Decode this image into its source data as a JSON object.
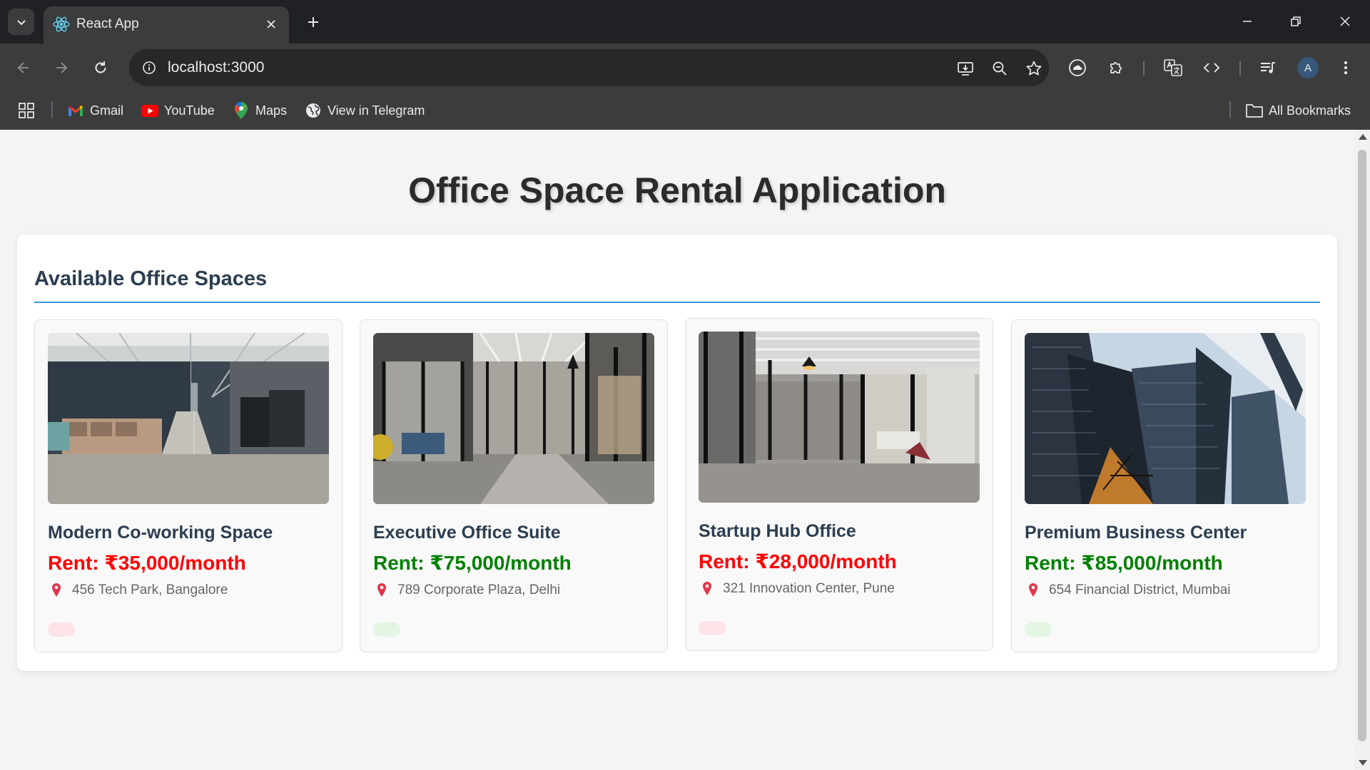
{
  "browser": {
    "tab_title": "React App",
    "url": "localhost:3000",
    "avatar_letter": "A",
    "bookmarks": [
      {
        "label": "Gmail",
        "icon": "gmail-icon"
      },
      {
        "label": "YouTube",
        "icon": "youtube-icon"
      },
      {
        "label": "Maps",
        "icon": "maps-icon"
      },
      {
        "label": "View in Telegram",
        "icon": "globe-icon"
      }
    ],
    "all_bookmarks_label": "All Bookmarks"
  },
  "page": {
    "title": "Office Space Rental Application",
    "section_title": "Available Office Spaces",
    "colors": {
      "expensive": "#008000",
      "affordable": "#ff0000",
      "accent": "#3498db"
    },
    "offices": [
      {
        "name": "Modern Co-working Space",
        "rent": "Rent: ₹35,000/month",
        "address": "456 Tech Park, Bangalore",
        "rent_color": "#ff0000",
        "badge_color": "#ffe3e6"
      },
      {
        "name": "Executive Office Suite",
        "rent": "Rent: ₹75,000/month",
        "address": "789 Corporate Plaza, Delhi",
        "rent_color": "#008000",
        "badge_color": "#e3f6e3"
      },
      {
        "name": "Startup Hub Office",
        "rent": "Rent: ₹28,000/month",
        "address": "321 Innovation Center, Pune",
        "rent_color": "#ff0000",
        "badge_color": "#ffe3e6"
      },
      {
        "name": "Premium Business Center",
        "rent": "Rent: ₹85,000/month",
        "address": "654 Financial District, Mumbai",
        "rent_color": "#008000",
        "badge_color": "#e3f6e3"
      }
    ]
  }
}
